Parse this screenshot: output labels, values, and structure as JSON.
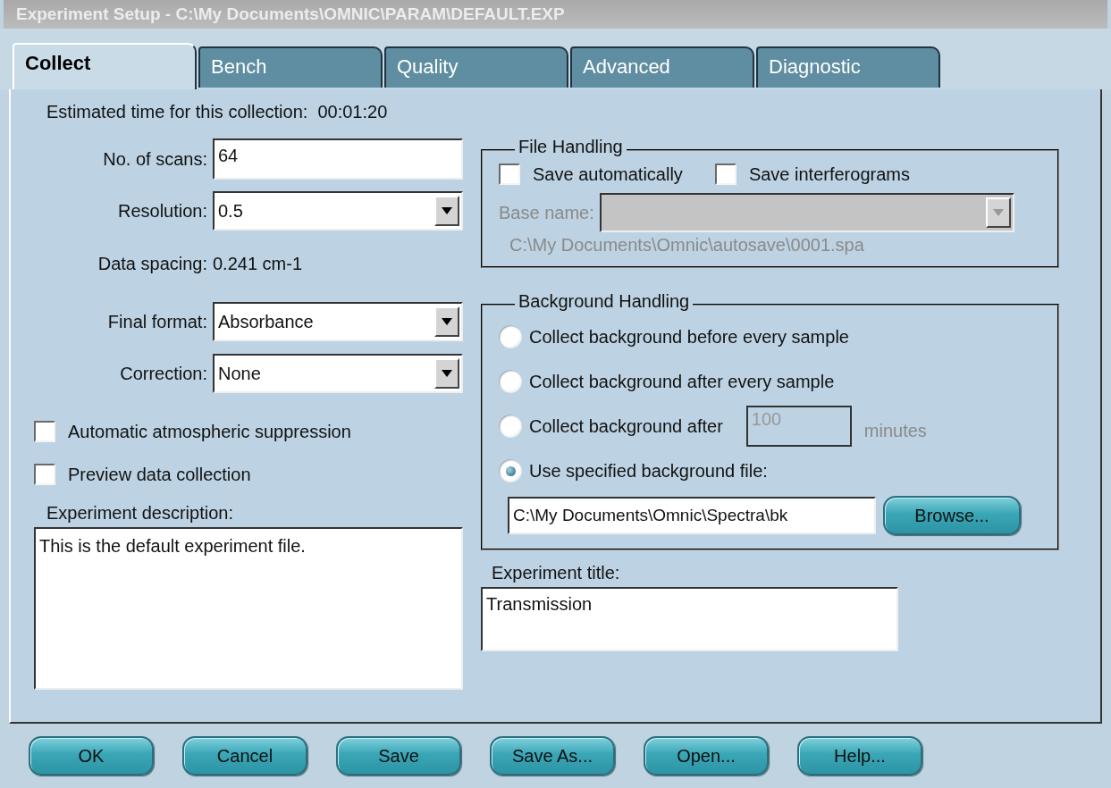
{
  "window": {
    "title": "Experiment Setup - C:\\My Documents\\OMNIC\\PARAM\\DEFAULT.EXP"
  },
  "tabs": [
    {
      "label": "Collect",
      "selected": true
    },
    {
      "label": "Bench",
      "selected": false
    },
    {
      "label": "Quality",
      "selected": false
    },
    {
      "label": "Advanced",
      "selected": false
    },
    {
      "label": "Diagnostic",
      "selected": false
    }
  ],
  "estimated_time": {
    "label": "Estimated time for this collection:",
    "value": "00:01:20"
  },
  "fields": [
    {
      "kind": "text",
      "label": "No. of scans:",
      "value": "64"
    },
    {
      "kind": "combo",
      "label": "Resolution:",
      "value": "0.5"
    },
    {
      "kind": "reading",
      "label": "Data spacing:",
      "value": "0.241 cm-1"
    },
    {
      "kind": "combo",
      "label": "Final format:",
      "value": "Absorbance"
    },
    {
      "kind": "combo",
      "label": "Correction:",
      "value": "None"
    }
  ],
  "options": [
    {
      "label": "Automatic atmospheric suppression",
      "checked": false
    },
    {
      "label": "Preview data collection",
      "checked": false
    }
  ],
  "description": {
    "label": "Experiment description:",
    "value": "This is the default experiment file."
  },
  "file_handling": {
    "title": "File Handling",
    "options": [
      {
        "label": "Save automatically",
        "checked": false
      },
      {
        "label": "Save interferograms",
        "checked": false
      }
    ],
    "base_name": {
      "label": "Base name:",
      "disabled": true
    },
    "path": "C:\\My Documents\\Omnic\\autosave\\0001.spa"
  },
  "background_handling": {
    "title": "Background Handling",
    "choices": [
      {
        "label": "Collect background before every sample",
        "selected": false
      },
      {
        "label": "Collect background after every sample",
        "selected": false
      },
      {
        "label": "Collect background after",
        "selected": false,
        "minutes": {
          "value": "100",
          "disabled": true,
          "unit": "minutes"
        }
      },
      {
        "label": "Use specified background file:",
        "selected": true
      }
    ],
    "file": {
      "value": "C:\\My Documents\\Omnic\\Spectra\\bk",
      "button": "Browse..."
    }
  },
  "experiment_title": {
    "label": "Experiment title:",
    "value": "Transmission"
  },
  "buttons": [
    "OK",
    "Cancel",
    "Save",
    "Save As...",
    "Open...",
    "Help..."
  ]
}
